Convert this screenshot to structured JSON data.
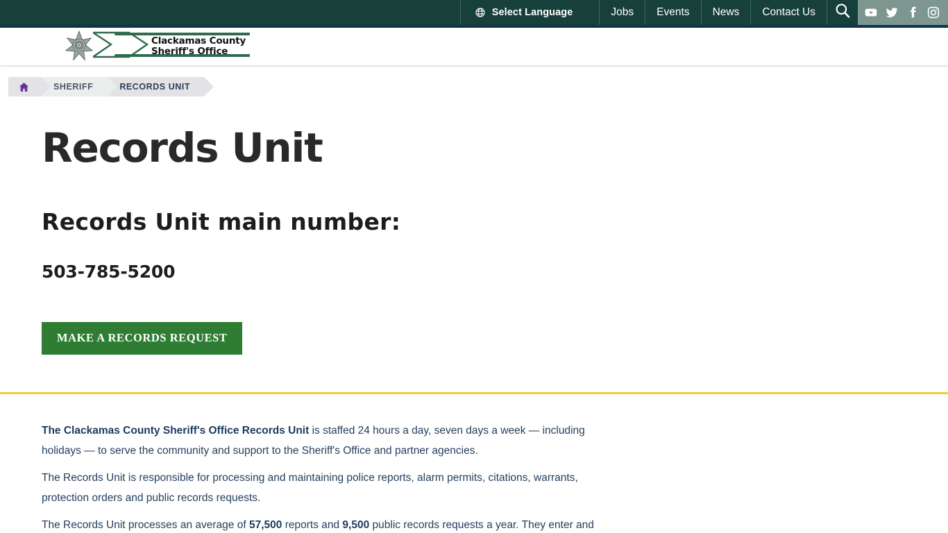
{
  "topbar": {
    "language_label": "Select Language",
    "language_icon": "globe-icon",
    "nav": [
      {
        "label": "Jobs"
      },
      {
        "label": "Events"
      },
      {
        "label": "News"
      },
      {
        "label": "Contact Us"
      }
    ],
    "search_icon": "search-icon",
    "social": [
      {
        "name": "youtube-icon"
      },
      {
        "name": "twitter-icon"
      },
      {
        "name": "facebook-icon"
      },
      {
        "name": "instagram-icon"
      }
    ],
    "colors": {
      "bar": "#17403a",
      "rule": "#10344f",
      "social_bg": "#7d9690"
    }
  },
  "logo": {
    "line1": "Clackamas County",
    "line2": "Sheriff's Office",
    "badge_icon": "sheriff-star-badge-icon"
  },
  "breadcrumb": {
    "home_icon": "home-icon",
    "items": [
      {
        "label": "SHERIFF"
      },
      {
        "label": "RECORDS UNIT"
      }
    ]
  },
  "hero": {
    "title": "Records Unit",
    "subtitle": "Records Unit main number:",
    "phone": "503-785-5200",
    "cta_label": "MAKE A RECORDS REQUEST",
    "cta_color": "#2e7d32",
    "divider_color": "#f0cf2e"
  },
  "content": {
    "p1_bold": "The Clackamas County Sheriff's Office Records Unit",
    "p1_rest": " is staffed 24 hours a day, seven days a week — including holidays — to serve the community and support to the Sheriff's Office and partner agencies.",
    "p2": "The Records Unit is responsible for processing and maintaining police reports, alarm permits, citations, warrants, protection orders and public records requests.",
    "p3_a": "The Records Unit processes an average of ",
    "p3_b1": "57,500",
    "p3_c": " reports and ",
    "p3_b2": "9,500",
    "p3_d": " public records requests a year.  They enter and"
  }
}
